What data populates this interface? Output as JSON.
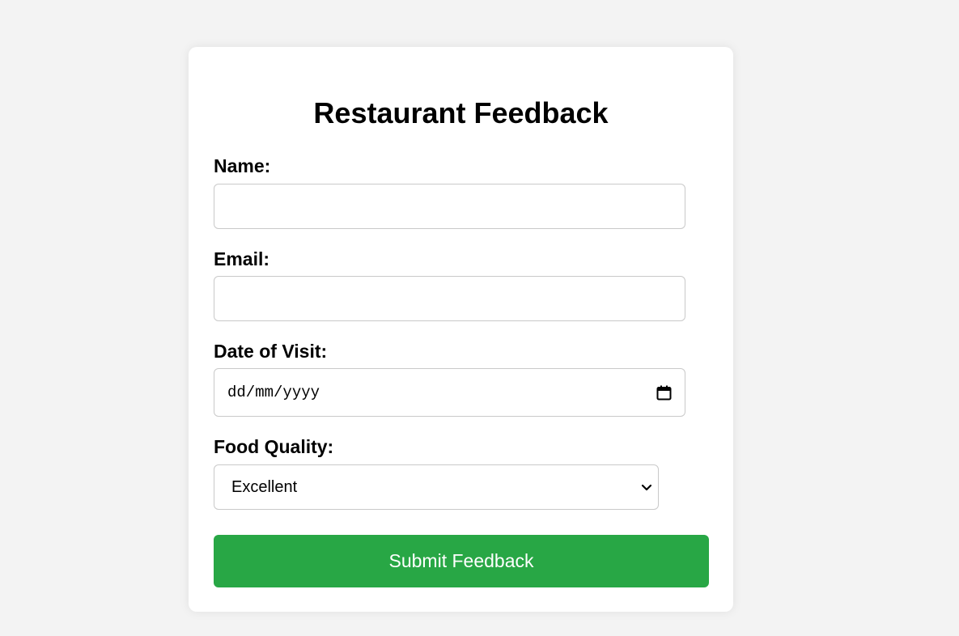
{
  "form": {
    "title": "Restaurant Feedback",
    "name_label": "Name:",
    "name_value": "",
    "email_label": "Email:",
    "email_value": "",
    "date_label": "Date of Visit:",
    "date_placeholder": "dd/mm/yyyy",
    "date_icon": "calendar-icon",
    "food_label": "Food Quality:",
    "food_selected": "Excellent",
    "select_icon": "chevron-down-icon",
    "submit_label": "Submit Feedback"
  },
  "colors": {
    "page_bg": "#f3f3f3",
    "card_bg": "#ffffff",
    "submit_bg": "#28a745",
    "submit_text": "#ffffff",
    "field_border": "#c9c9c9"
  }
}
